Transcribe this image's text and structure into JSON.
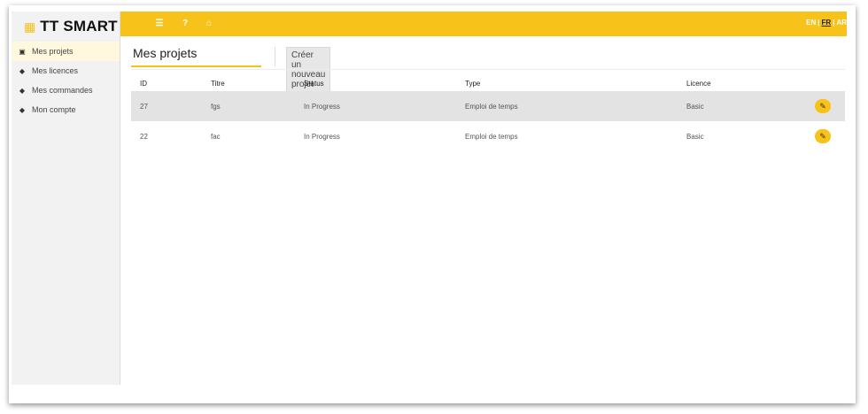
{
  "brand": {
    "icon": "calendar-icon",
    "title": "TT SMART"
  },
  "sidebar": {
    "items": [
      {
        "label": "Mes projets",
        "icon": "project-icon",
        "active": true
      },
      {
        "label": "Mes licences",
        "icon": "stack-icon",
        "active": false
      },
      {
        "label": "Mes commandes",
        "icon": "stack-icon",
        "active": false
      },
      {
        "label": "Mon compte",
        "icon": "stack-icon",
        "active": false
      }
    ]
  },
  "topbar": {
    "menu_icon": "☰",
    "help_icon": "?",
    "home_icon": "⌂",
    "lang": {
      "en": "EN",
      "fr": "FR",
      "ar": "AR",
      "sep": "|"
    }
  },
  "main": {
    "tab_label": "Mes projets",
    "create_button": "Créer un nouveau projet"
  },
  "table": {
    "headers": [
      "ID",
      "Titre",
      "Status",
      "Type",
      "Licence"
    ],
    "rows": [
      {
        "id": "27",
        "titre": "fgs",
        "status": "In Progress",
        "type": "Emploi de temps",
        "licence": "Basic"
      },
      {
        "id": "22",
        "titre": "fac",
        "status": "In Progress",
        "type": "Emploi de temps",
        "licence": "Basic"
      }
    ]
  },
  "colors": {
    "accent": "#f7c21a",
    "row_shade": "#e3e3e3",
    "sidebar_bg": "#f2f2f2"
  }
}
